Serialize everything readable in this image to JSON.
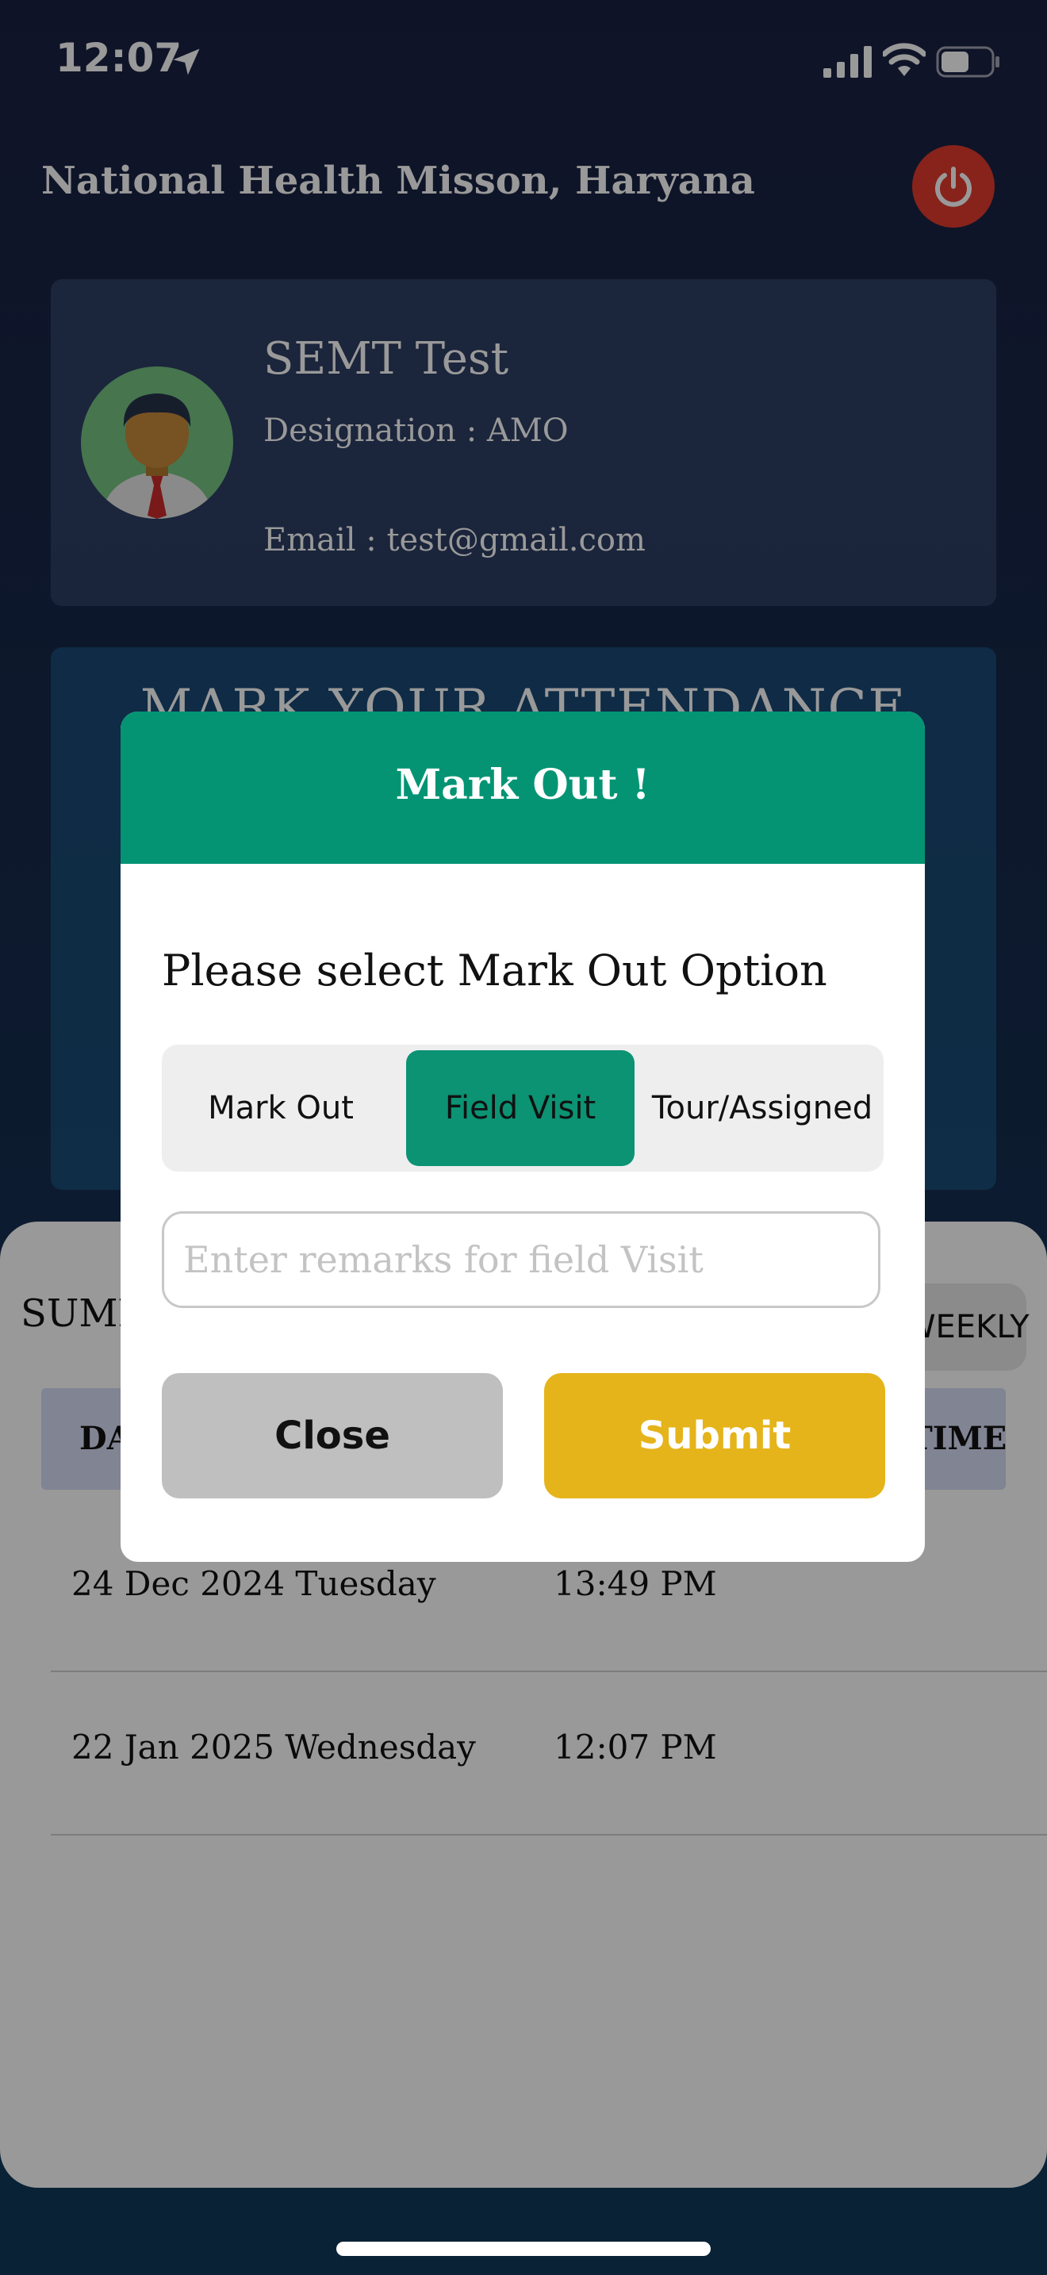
{
  "status_bar": {
    "time": "12:07"
  },
  "header": {
    "title": "National Health Misson, Haryana"
  },
  "profile": {
    "name": "SEMT Test",
    "designation": "Designation : AMO",
    "email": "Email : test@gmail.com"
  },
  "attendance": {
    "title": "MARK YOUR ATTENDANCE"
  },
  "summary": {
    "label": "SUMMARY",
    "weekly_label": "WEEKLY",
    "col_date": "DATE",
    "col_time": "TIME",
    "rows": [
      {
        "date": "24 Dec 2024 Tuesday",
        "time": "13:49 PM"
      },
      {
        "date": "22 Jan 2025 Wednesday",
        "time": "12:07 PM"
      }
    ]
  },
  "modal": {
    "title": "Mark Out !",
    "prompt": "Please select Mark Out Option",
    "options": [
      "Mark Out",
      "Field Visit",
      "Tour/Assigned"
    ],
    "selected": "Field Visit",
    "remarks_placeholder": "Enter remarks for field Visit",
    "remarks_value": "",
    "close_label": "Close",
    "submit_label": "Submit"
  },
  "colors": {
    "primary": "#049474",
    "submit": "#e5b41a",
    "power": "#e23b2e"
  }
}
